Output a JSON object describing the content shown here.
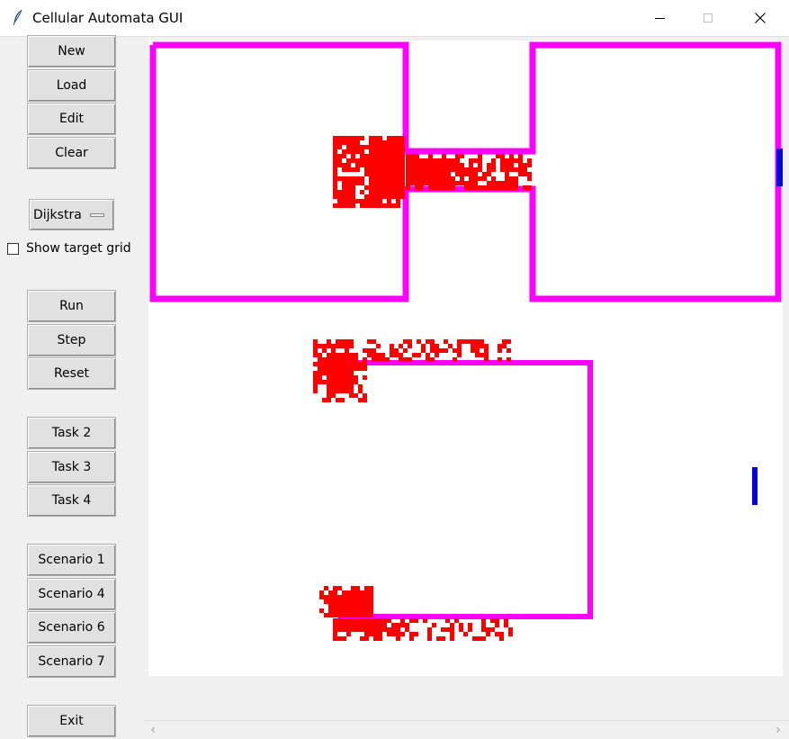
{
  "window": {
    "title": "Cellular Automata GUI"
  },
  "sidebar": {
    "file_buttons": [
      "New",
      "Load",
      "Edit",
      "Clear"
    ],
    "algorithm": {
      "selected": "Dijkstra"
    },
    "show_target_grid": {
      "label": "Show target grid",
      "checked": false
    },
    "sim_buttons": [
      "Run",
      "Step",
      "Reset"
    ],
    "task_buttons": [
      "Task 2",
      "Task 3",
      "Task 4"
    ],
    "scenario_buttons": [
      "Scenario 1",
      "Scenario 4",
      "Scenario 6",
      "Scenario 7"
    ],
    "exit_button": "Exit"
  },
  "canvas": {
    "background": "#ffffff",
    "colors": {
      "obstacle": "#ff00ff",
      "pedestrian": "#ff0000",
      "target": "#0000e0"
    }
  },
  "icons": {
    "app": "feather-icon",
    "minimize": "minimize-icon",
    "maximize": "maximize-icon",
    "close": "close-icon",
    "scroll_left": "chevron-left-icon",
    "scroll_right": "chevron-right-icon"
  }
}
